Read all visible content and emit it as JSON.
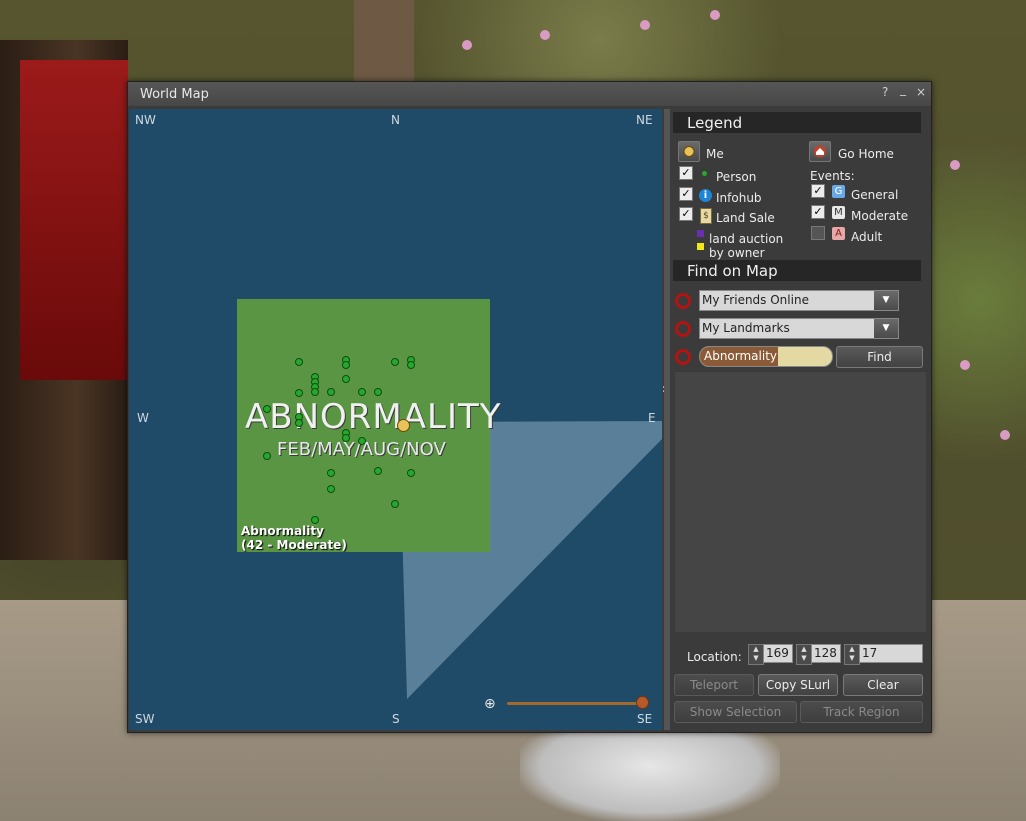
{
  "window": {
    "title": "World Map",
    "help": "?",
    "minimize": "_",
    "close": "×"
  },
  "map": {
    "compass": {
      "nw": "NW",
      "n": "N",
      "ne": "NE",
      "w": "W",
      "e": "E",
      "sw": "SW",
      "s": "S",
      "se": "SE"
    },
    "region_logo_title": "ABNORMALITY",
    "region_logo_sub": "FEB/MAY/AUG/NOV",
    "region_name": "Abnormality",
    "region_info": "(42 - Moderate)",
    "zoom_level": 1.0,
    "colors": {
      "water": "#1f4b69",
      "land": "#5a9544",
      "avatar_dot": "#27a82d"
    }
  },
  "legend": {
    "header": "Legend",
    "me": "Me",
    "go_home": "Go Home",
    "person": "Person",
    "infohub": "Infohub",
    "land_sale": "Land Sale",
    "land_auction": "land auction",
    "by_owner": "by owner",
    "events_label": "Events:",
    "general": "General",
    "moderate": "Moderate",
    "adult": "Adult",
    "general_badge": "G",
    "moderate_badge": "M",
    "adult_badge": "A"
  },
  "find": {
    "header": "Find on Map",
    "friends_combo": "My Friends Online",
    "landmarks_combo": "My Landmarks",
    "search_value": "Abnormality",
    "find_button": "Find"
  },
  "location": {
    "label": "Location:",
    "x": "169",
    "y": "128",
    "z": "17"
  },
  "buttons": {
    "teleport": "Teleport",
    "copy_slurl": "Copy SLurl",
    "clear": "Clear",
    "show_selection": "Show Selection",
    "track_region": "Track Region"
  }
}
